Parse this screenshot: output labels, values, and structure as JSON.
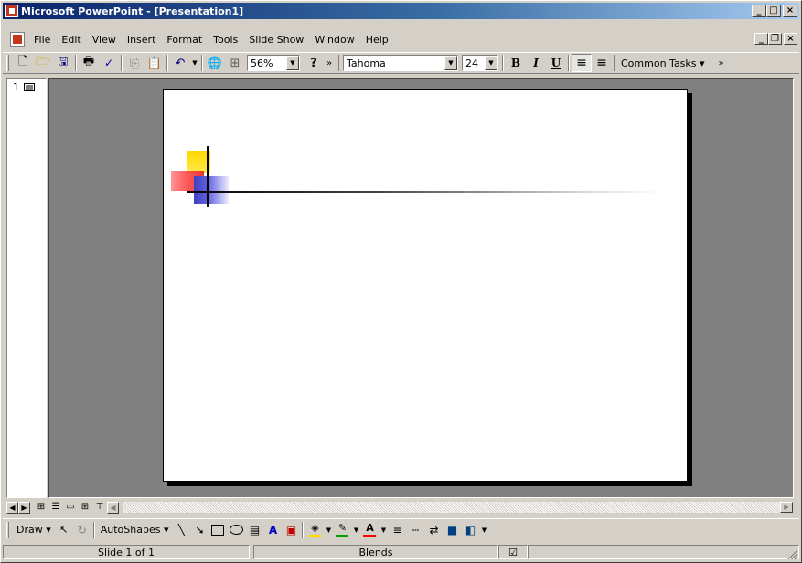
{
  "window": {
    "title": "Microsoft PowerPoint - [Presentation1]",
    "controls": [
      "_",
      "□",
      "×"
    ],
    "mdi_controls": [
      "_",
      "❐",
      "×"
    ]
  },
  "menu": {
    "items": [
      "File",
      "Edit",
      "View",
      "Insert",
      "Format",
      "Tools",
      "Slide Show",
      "Window",
      "Help"
    ]
  },
  "toolbar": {
    "zoom": "56%",
    "font_name": "Tahoma",
    "font_size": "24",
    "bold": "B",
    "italic": "I",
    "underline": "U",
    "common_tasks": "Common Tasks ▾",
    "overflow": "»"
  },
  "outline": {
    "slide_number": "1"
  },
  "drawing_toolbar": {
    "draw_label": "Draw ▾",
    "autoshapes_label": "AutoShapes ▾",
    "fill_color": "#ffd800",
    "line_color": "#00a000",
    "font_color": "#ff0000"
  },
  "status": {
    "slide": "Slide 1 of 1",
    "design": "Blends"
  },
  "colors": {
    "title_bar_start": "#0a246a",
    "title_bar_end": "#a6caf0",
    "workspace": "#808080",
    "logo_yellow": "#ffd800",
    "logo_red": "#ff5050",
    "logo_blue": "#4040c0"
  },
  "icons": [
    "new-icon",
    "open-icon",
    "save-icon",
    "print-icon",
    "spelling-icon",
    "copy-icon",
    "paste-icon",
    "undo-icon",
    "hyperlink-icon",
    "tables-icon",
    "help-icon",
    "align-left-icon",
    "center-icon"
  ]
}
